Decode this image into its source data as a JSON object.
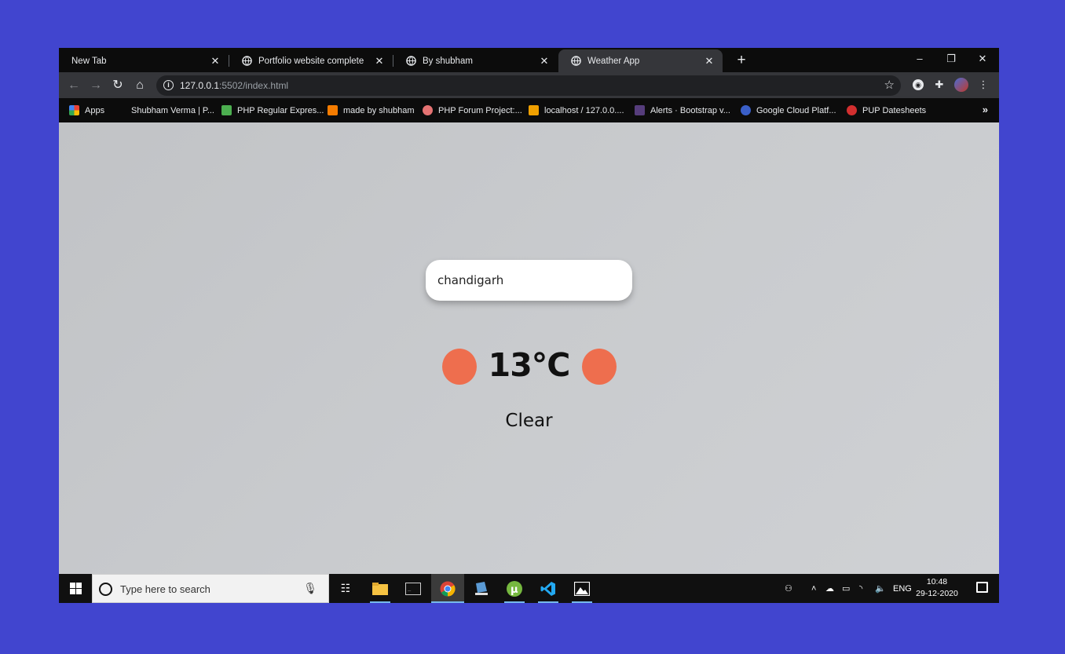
{
  "browser": {
    "tabs": [
      {
        "label": "New Tab",
        "active": false
      },
      {
        "label": "Portfolio website complete",
        "active": false
      },
      {
        "label": "By shubham",
        "active": false
      },
      {
        "label": "Weather App",
        "active": true
      }
    ],
    "url_host": "127.0.0.1",
    "url_rest": ":5502/index.html",
    "bookmarks": [
      "Apps",
      "Shubham Verma | P...",
      "PHP Regular Expres...",
      "made by shubham",
      "PHP Forum Project:...",
      "localhost / 127.0.0....",
      "Alerts · Bootstrap v...",
      "Google Cloud Platf...",
      "PUP Datesheets"
    ],
    "bookmarks_more": "»"
  },
  "app": {
    "search_value": "chandigarh",
    "temperature": "13°C",
    "condition": "Clear",
    "accent_color": "#ee6e4e",
    "background_color": "#c9cbce"
  },
  "taskbar": {
    "search_placeholder": "Type here to search",
    "language": "ENG",
    "time": "10:48",
    "date": "29-12-2020",
    "pinned_icons": [
      "task-view-icon",
      "file-explorer-icon",
      "terminal-icon",
      "chrome-icon",
      "app-icon",
      "utorrent-icon",
      "vscode-icon",
      "photos-icon"
    ]
  }
}
